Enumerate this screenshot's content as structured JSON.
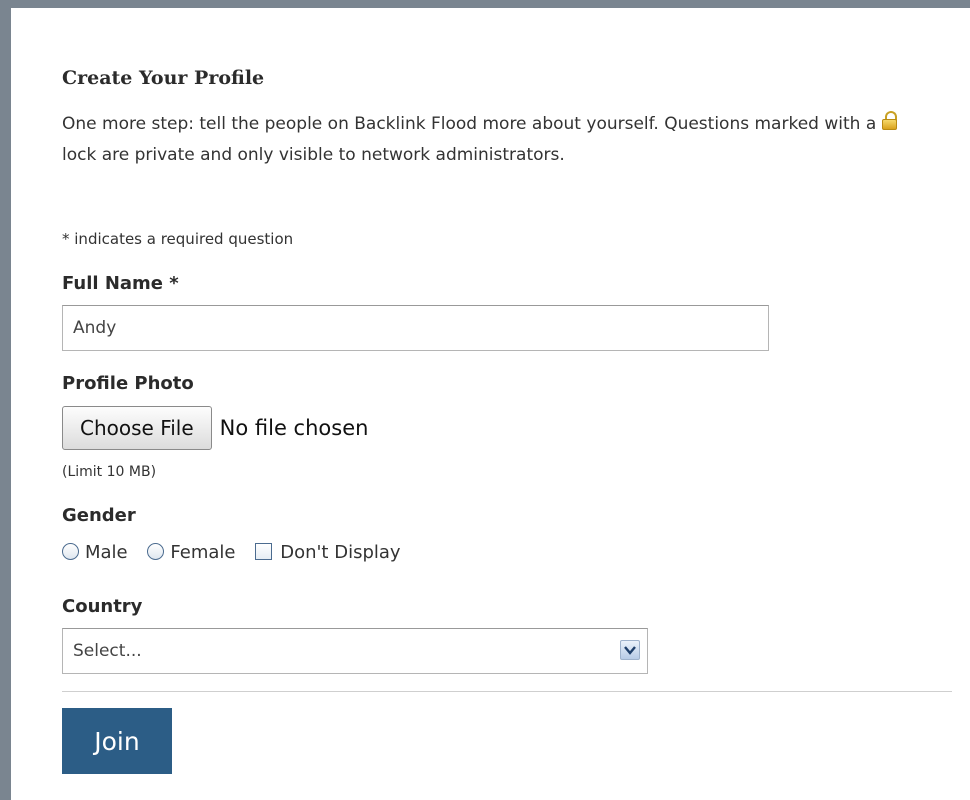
{
  "form": {
    "title": "Create Your Profile",
    "intro": {
      "before_lock": "One more step: tell the people on Backlink Flood more about yourself. Questions marked with a ",
      "lock_icon": "lock-icon",
      "after_lock": "lock are private and only visible to network administrators."
    },
    "required_note": "* indicates a required question",
    "full_name": {
      "label": "Full Name *",
      "value": "Andy"
    },
    "profile_photo": {
      "label": "Profile Photo",
      "button_label": "Choose File",
      "status": "No file chosen",
      "limit": "(Limit 10 MB)"
    },
    "gender": {
      "label": "Gender",
      "options": [
        "Male",
        "Female"
      ],
      "dont_display": "Don't Display"
    },
    "country": {
      "label": "Country",
      "selected": "Select..."
    },
    "join_label": "Join"
  },
  "colors": {
    "frame": "#7a8590",
    "join_button": "#2c5d86",
    "lock_icon": "#e8b93a"
  }
}
